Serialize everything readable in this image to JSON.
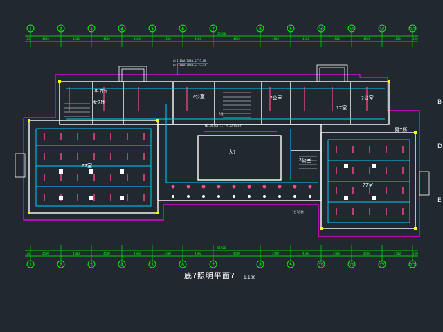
{
  "drawing": {
    "title": "底?照明平面?",
    "scale": "1:100",
    "colors": {
      "background": "#212830",
      "axis": "#00ff00",
      "wall": "#ffffff",
      "outline": "#ff00ff",
      "wiring": "#00ccff",
      "fixture": "#ff4d8a",
      "text": "#ffffff",
      "column": "#ffff00"
    }
  },
  "axes": {
    "labels": [
      "1",
      "2",
      "3",
      "4",
      "5",
      "6",
      "7",
      "8",
      "9",
      "10",
      "11",
      "12",
      "13"
    ],
    "spacings": [
      "120",
      "4500",
      "4500",
      "4500",
      "4500",
      "4500",
      "4500",
      "4500",
      "4500",
      "4500",
      "4500",
      "4500",
      "4500",
      "120"
    ],
    "total": "55200",
    "right_side_labels": [
      "B",
      "D",
      "E"
    ]
  },
  "rooms": {
    "big_hall_left": "?7室",
    "hall": "大?",
    "big_hall_right": "?7室",
    "toilet_left": "男7所",
    "toilet_left_2": "女7所",
    "office_1": "?公室",
    "office_2": "?公室",
    "office_3": "?7室",
    "office_4": "?公室",
    "office_5": "?公室",
    "toilet_right": "男7所"
  },
  "notes": {
    "panel_note_1": "AL0-BVV-3X10-SC32-WC",
    "panel_note_2": "AL1-BVV-3X10-SC32-FC",
    "panel_note_3": "MB-PT/SR-3-1.5-SC20-CC",
    "riser": "?线",
    "exterior": "?台?台阶"
  }
}
